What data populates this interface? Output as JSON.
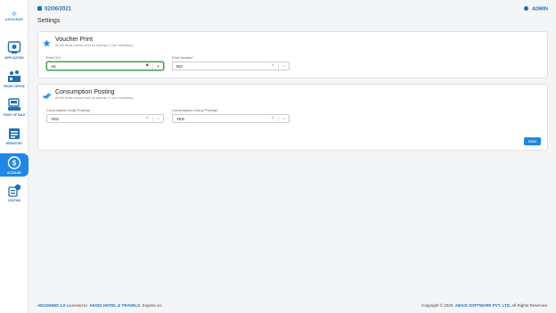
{
  "brand": {
    "name": "AEGISHMS"
  },
  "nav": [
    {
      "key": "application",
      "label": "APPLICATION",
      "icon": "application-icon"
    },
    {
      "key": "front-office",
      "label": "FRONT OFFICE",
      "icon": "front-office-icon"
    },
    {
      "key": "point-of-sale",
      "label": "POINT OF SALE",
      "icon": "point-of-sale-icon"
    },
    {
      "key": "inventory",
      "label": "INVENTORY",
      "icon": "inventory-icon"
    },
    {
      "key": "account",
      "label": "ACCOUNT",
      "icon": "account-icon",
      "active": true
    },
    {
      "key": "costing",
      "label": "COSTING",
      "icon": "costing-icon"
    }
  ],
  "header": {
    "date": "02/06/2021",
    "user": "ADMIN"
  },
  "page": {
    "title": "Settings"
  },
  "sections": [
    {
      "title": "Voucher Print",
      "subtitle": "All the fields marked with an asterisk (*) are mandatory.",
      "fields": [
        {
          "label": "Print On",
          "value": "A5"
        },
        {
          "label": "Print Header",
          "value": "NO"
        }
      ]
    },
    {
      "title": "Consumption Posting",
      "subtitle": "All the fields marked with an asterisk (*) are mandatory.",
      "fields": [
        {
          "label": "Consumption Daily Posting",
          "value": "YES"
        },
        {
          "label": "Consumption Group Posting",
          "value": "YES"
        }
      ]
    }
  ],
  "actions": {
    "save": "Save"
  },
  "footer": {
    "product": "AEGISHMS 1.0",
    "licensed_text": "Licensed to:",
    "licensee": "AEGIS HOTEL & TRAVELS",
    "expires_text": "Expires on:",
    "copyright_text": "Copyright © 2020.",
    "company": "AEGIS SOFTWARE PVT. LTD.",
    "rights": "All Rights Reserved."
  },
  "colors": {
    "accent": "#1e88e5",
    "focus": "#43a047",
    "required": "#e53935"
  }
}
